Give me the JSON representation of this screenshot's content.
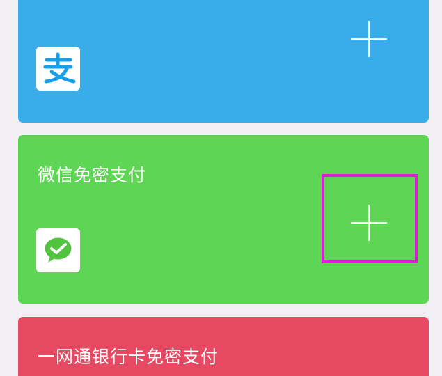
{
  "cards": {
    "alipay": {
      "icon": "alipay-logo-icon",
      "add_icon": "plus-icon",
      "color": "#39adea"
    },
    "wechat": {
      "title": "微信免密支付",
      "icon": "wechat-pay-logo-icon",
      "add_icon": "plus-icon",
      "color": "#5ed555",
      "highlight_color": "#e01bd8"
    },
    "bank": {
      "title": "一网通银行卡免密支付",
      "color": "#e64961"
    }
  }
}
